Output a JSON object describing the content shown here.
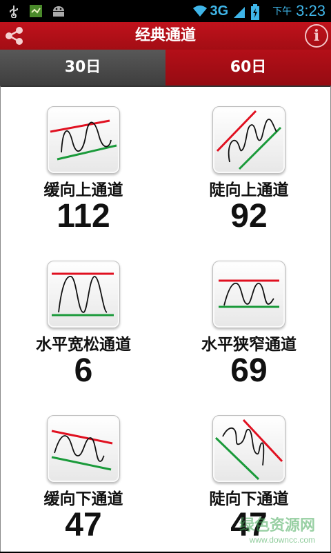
{
  "status_bar": {
    "network": "3G",
    "ampm": "下午",
    "time": "3:23",
    "icons": [
      "usb-icon",
      "app-icon",
      "android-icon",
      "wifi-icon",
      "signal-icon",
      "battery-icon"
    ]
  },
  "header": {
    "title": "经典通道",
    "share_icon": "share-icon",
    "info_label": "i"
  },
  "tabs": [
    {
      "label": "30日",
      "selected": false
    },
    {
      "label": "60日",
      "selected": true
    }
  ],
  "channels": [
    {
      "name": "缓向上通道",
      "count": "112",
      "icon": "gentle-up-channel-icon"
    },
    {
      "name": "陡向上通道",
      "count": "92",
      "icon": "steep-up-channel-icon"
    },
    {
      "name": "水平宽松通道",
      "count": "6",
      "icon": "wide-horizontal-channel-icon"
    },
    {
      "name": "水平狭窄通道",
      "count": "69",
      "icon": "narrow-horizontal-channel-icon"
    },
    {
      "name": "缓向下通道",
      "count": "47",
      "icon": "gentle-down-channel-icon"
    },
    {
      "name": "陡向下通道",
      "count": "47",
      "icon": "steep-down-channel-icon"
    }
  ],
  "watermark": {
    "title": "绿色资源网",
    "url": "www.downcc.com"
  },
  "colors": {
    "brand_red": "#b40f18",
    "tab_inactive": "#4a4a4a",
    "upper_line": "#e01020",
    "lower_line": "#1a9a3a",
    "status_blue": "#3fb5e8"
  }
}
